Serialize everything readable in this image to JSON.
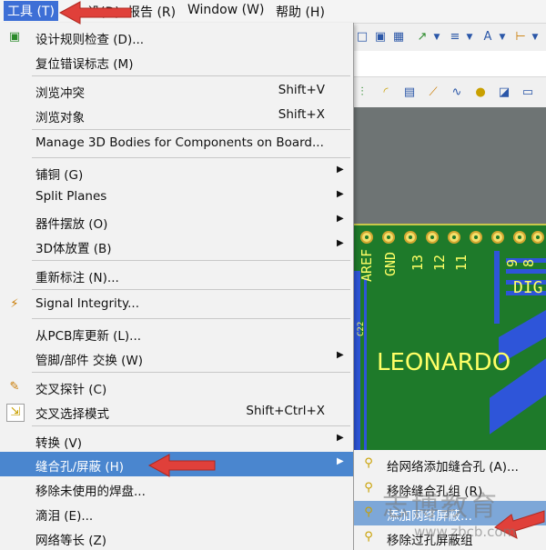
{
  "menubar": [
    {
      "label": "工具 (T)",
      "active": true
    },
    {
      "label": "设(D)",
      "active": false
    },
    {
      "label": "报告 (R)",
      "active": false
    },
    {
      "label": "Window (W)",
      "active": false
    },
    {
      "label": "帮助 (H)",
      "active": false
    }
  ],
  "menu": {
    "items": [
      {
        "label": "设计规则检查 (D)...",
        "shortcut": "",
        "submenu": false,
        "icon": "drc-icon"
      },
      {
        "label": "复位错误标志 (M)",
        "shortcut": "",
        "submenu": false,
        "icon": ""
      },
      {
        "label": "浏览冲突",
        "shortcut": "Shift+V",
        "submenu": false,
        "icon": ""
      },
      {
        "label": "浏览对象",
        "shortcut": "Shift+X",
        "submenu": false,
        "icon": ""
      },
      {
        "label": "Manage 3D Bodies for Components on Board...",
        "shortcut": "",
        "submenu": false,
        "icon": ""
      },
      {
        "label": "铺铜 (G)",
        "shortcut": "",
        "submenu": true,
        "icon": ""
      },
      {
        "label": "Split Planes",
        "shortcut": "",
        "submenu": true,
        "icon": ""
      },
      {
        "label": "器件摆放 (O)",
        "shortcut": "",
        "submenu": true,
        "icon": ""
      },
      {
        "label": "3D体放置 (B)",
        "shortcut": "",
        "submenu": true,
        "icon": ""
      },
      {
        "label": "重新标注 (N)...",
        "shortcut": "",
        "submenu": false,
        "icon": ""
      },
      {
        "label": "Signal Integrity...",
        "shortcut": "",
        "submenu": false,
        "icon": "signal-integrity-icon"
      },
      {
        "label": "从PCB库更新 (L)...",
        "shortcut": "",
        "submenu": false,
        "icon": ""
      },
      {
        "label": "管脚/部件 交换 (W)",
        "shortcut": "",
        "submenu": true,
        "icon": ""
      },
      {
        "label": "交叉探针 (C)",
        "shortcut": "",
        "submenu": false,
        "icon": "cross-probe-icon"
      },
      {
        "label": "交叉选择模式",
        "shortcut": "Shift+Ctrl+X",
        "submenu": false,
        "icon": "cross-select-icon"
      },
      {
        "label": "转换 (V)",
        "shortcut": "",
        "submenu": true,
        "icon": ""
      },
      {
        "label": "缝合孔/屏蔽 (H)",
        "shortcut": "",
        "submenu": true,
        "icon": "",
        "highlighted": true
      },
      {
        "label": "移除未使用的焊盘...",
        "shortcut": "",
        "submenu": false,
        "icon": ""
      },
      {
        "label": "滴泪 (E)...",
        "shortcut": "",
        "submenu": false,
        "icon": ""
      },
      {
        "label": "网络等长 (Z)",
        "shortcut": "",
        "submenu": false,
        "icon": ""
      }
    ]
  },
  "submenu": {
    "items": [
      {
        "label": "给网络添加缝合孔 (A)...",
        "highlighted": false
      },
      {
        "label": "移除缝合孔组 (R)",
        "highlighted": false
      },
      {
        "label": "添加网络屏蔽...",
        "highlighted": true
      },
      {
        "label": "移除过孔屏蔽组",
        "highlighted": false
      }
    ]
  },
  "pcb": {
    "silk_labels": [
      "AREF",
      "GND",
      "13",
      "12",
      "11",
      "9",
      "8",
      "DIG",
      "LEONARDO",
      "C22"
    ]
  },
  "watermark": {
    "title": "志博教育",
    "url": "www.zbcb.com"
  },
  "colors": {
    "menu_highlight": "#4a86cf",
    "pcb_board": "#1e7a2a",
    "pcb_trace": "#2e55d9",
    "silkscreen": "#ffff66",
    "annotation_arrow": "#e0403a"
  }
}
